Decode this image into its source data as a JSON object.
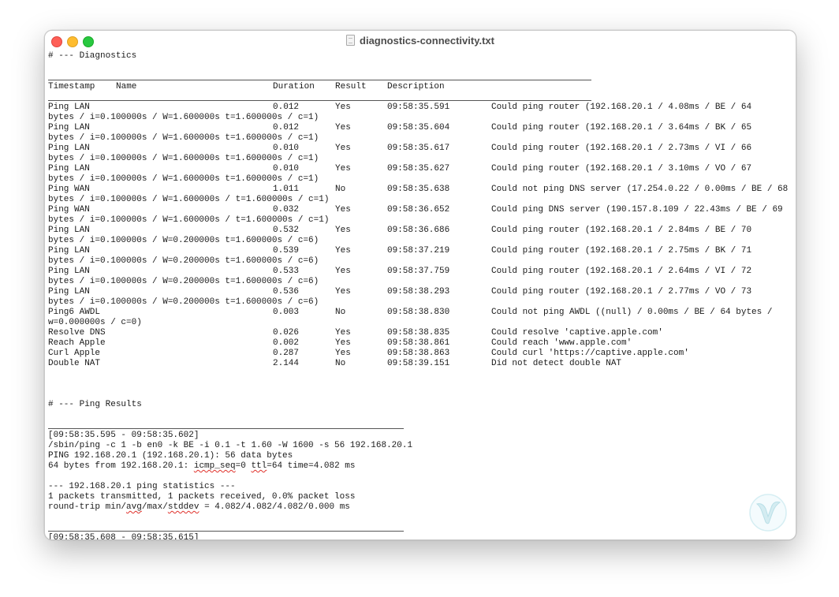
{
  "window": {
    "title": "diagnostics-connectivity.txt"
  },
  "diagnostics": {
    "heading": "# --- Diagnostics",
    "columns": [
      "Timestamp",
      "Name",
      "Duration",
      "Result",
      "Description"
    ],
    "rows": [
      {
        "name": "Ping LAN",
        "duration": "0.012",
        "result": "Yes",
        "time": "09:58:35.591",
        "desc": "Could ping router (192.168.20.1 / 4.08ms / BE / 64",
        "cont": "bytes / i=0.100000s / W=1.600000s t=1.600000s / c=1)"
      },
      {
        "name": "Ping LAN",
        "duration": "0.012",
        "result": "Yes",
        "time": "09:58:35.604",
        "desc": "Could ping router (192.168.20.1 / 3.64ms / BK / 65",
        "cont": "bytes / i=0.100000s / W=1.600000s t=1.600000s / c=1)"
      },
      {
        "name": "Ping LAN",
        "duration": "0.010",
        "result": "Yes",
        "time": "09:58:35.617",
        "desc": "Could ping router (192.168.20.1 / 2.73ms / VI / 66",
        "cont": "bytes / i=0.100000s / W=1.600000s t=1.600000s / c=1)"
      },
      {
        "name": "Ping LAN",
        "duration": "0.010",
        "result": "Yes",
        "time": "09:58:35.627",
        "desc": "Could ping router (192.168.20.1 / 3.10ms / VO / 67",
        "cont": "bytes / i=0.100000s / W=1.600000s t=1.600000s / c=1)"
      },
      {
        "name": "Ping WAN",
        "duration": "1.011",
        "result": "No",
        "time": "09:58:35.638",
        "desc": "Could not ping DNS server (17.254.0.22 / 0.00ms / BE / 68",
        "cont": "bytes / i=0.100000s / W=1.600000s / t=1.600000s / c=1)"
      },
      {
        "name": "Ping WAN",
        "duration": "0.032",
        "result": "Yes",
        "time": "09:58:36.652",
        "desc": "Could ping DNS server (190.157.8.109 / 22.43ms / BE / 69",
        "cont": "bytes / i=0.100000s / W=1.600000s / t=1.600000s / c=1)"
      },
      {
        "name": "Ping LAN",
        "duration": "0.532",
        "result": "Yes",
        "time": "09:58:36.686",
        "desc": "Could ping router (192.168.20.1 / 2.84ms / BE / 70",
        "cont": "bytes / i=0.100000s / W=0.200000s t=1.600000s / c=6)"
      },
      {
        "name": "Ping LAN",
        "duration": "0.539",
        "result": "Yes",
        "time": "09:58:37.219",
        "desc": "Could ping router (192.168.20.1 / 2.75ms / BK / 71",
        "cont": "bytes / i=0.100000s / W=0.200000s t=1.600000s / c=6)"
      },
      {
        "name": "Ping LAN",
        "duration": "0.533",
        "result": "Yes",
        "time": "09:58:37.759",
        "desc": "Could ping router (192.168.20.1 / 2.64ms / VI / 72",
        "cont": "bytes / i=0.100000s / W=0.200000s t=1.600000s / c=6)"
      },
      {
        "name": "Ping LAN",
        "duration": "0.536",
        "result": "Yes",
        "time": "09:58:38.293",
        "desc": "Could ping router (192.168.20.1 / 2.77ms / VO / 73",
        "cont": "bytes / i=0.100000s / W=0.200000s t=1.600000s / c=6)"
      },
      {
        "name": "Ping6 AWDL",
        "duration": "0.003",
        "result": "No",
        "time": "09:58:38.830",
        "desc": "Could not ping AWDL ((null) / 0.00ms / BE / 64 bytes /",
        "cont": "w=0.000000s / c=0)"
      },
      {
        "name": "Resolve DNS",
        "duration": "0.026",
        "result": "Yes",
        "time": "09:58:38.835",
        "desc": "Could resolve 'captive.apple.com'",
        "cont": ""
      },
      {
        "name": "Reach Apple",
        "duration": "0.002",
        "result": "Yes",
        "time": "09:58:38.861",
        "desc": "Could reach 'www.apple.com'",
        "cont": ""
      },
      {
        "name": "Curl Apple",
        "duration": "0.287",
        "result": "Yes",
        "time": "09:58:38.863",
        "desc": "Could curl 'https://captive.apple.com'",
        "cont": ""
      },
      {
        "name": "Double NAT",
        "duration": "2.144",
        "result": "No",
        "time": "09:58:39.151",
        "desc": "Did not detect double NAT",
        "cont": ""
      }
    ]
  },
  "ping_results": {
    "heading": "# --- Ping Results",
    "lines": {
      "range": "[09:58:35.595 - 09:58:35.602]",
      "cmd": "/sbin/ping -c 1 -b en0 -k BE -i 0.1 -t 1.60 -W 1600 -s 56 192.168.20.1",
      "ping": "PING 192.168.20.1 (192.168.20.1): 56 data bytes",
      "reply_a": "64 bytes from 192.168.20.1: ",
      "reply_seq": "icmp_seq",
      "reply_b": "=0 ",
      "reply_ttl": "ttl",
      "reply_c": "=64 time=4.082 ms",
      "stats": "--- 192.168.20.1 ping statistics ---",
      "packets": "1 packets transmitted, 1 packets received, 0.0% packet loss",
      "rtt_a": "round-trip min/",
      "rtt_avg": "avg",
      "rtt_b": "/max/",
      "rtt_stddev": "stddev",
      "rtt_c": " = 4.082/4.082/4.082/0.000 ms",
      "next_range": "[09:58:35.608 - 09:58:35.615]"
    }
  },
  "icons": {
    "file": "document-icon",
    "watermark": "stylized-v-logo-icon"
  },
  "colors": {
    "close": "#fe5f57",
    "minimize": "#febc2e",
    "maximize": "#28c840",
    "spell_underline": "#e0312b"
  }
}
